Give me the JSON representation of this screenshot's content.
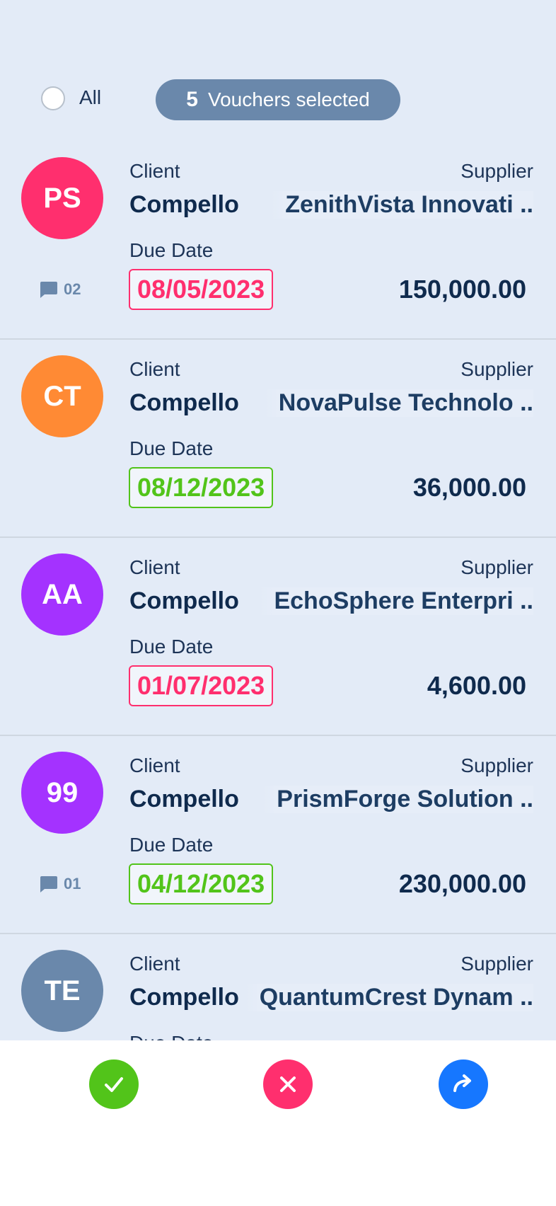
{
  "header": {
    "select_all_label": "All",
    "selected_count": "5",
    "selected_text": "Vouchers selected"
  },
  "labels": {
    "client": "Client",
    "supplier": "Supplier",
    "due_date": "Due Date"
  },
  "vouchers": [
    {
      "initials": "PS",
      "avatar_color": "#ff2f6e",
      "client": "Compello",
      "supplier": "ZenithVista Innovati ..",
      "due_date": "08/05/2023",
      "due_status": "overdue",
      "amount": "150,000.00",
      "comments": "02"
    },
    {
      "initials": "CT",
      "avatar_color": "#ff8a34",
      "client": "Compello",
      "supplier": "NovaPulse Technolo ..",
      "due_date": "08/12/2023",
      "due_status": "upcoming",
      "amount": "36,000.00",
      "comments": ""
    },
    {
      "initials": "AA",
      "avatar_color": "#a432ff",
      "client": "Compello",
      "supplier": "EchoSphere Enterpri ..",
      "due_date": "01/07/2023",
      "due_status": "overdue",
      "amount": "4,600.00",
      "comments": ""
    },
    {
      "initials": "99",
      "avatar_color": "#a432ff",
      "client": "Compello",
      "supplier": "PrismForge Solution ..",
      "due_date": "04/12/2023",
      "due_status": "upcoming",
      "amount": "230,000.00",
      "comments": "01"
    },
    {
      "initials": "TE",
      "avatar_color": "#6a88ab",
      "client": "Compello",
      "supplier": "QuantumCrest Dynam ..",
      "due_date": "",
      "due_status": "",
      "amount": "",
      "comments": ""
    }
  ],
  "colors": {
    "overdue": "#ff2f6e",
    "upcoming": "#52c41a",
    "approve": "#52c41a",
    "reject": "#ff2f6e",
    "forward": "#1677ff"
  },
  "actions": {
    "approve_icon": "check-icon",
    "reject_icon": "close-icon",
    "forward_icon": "forward-arrow-icon"
  }
}
